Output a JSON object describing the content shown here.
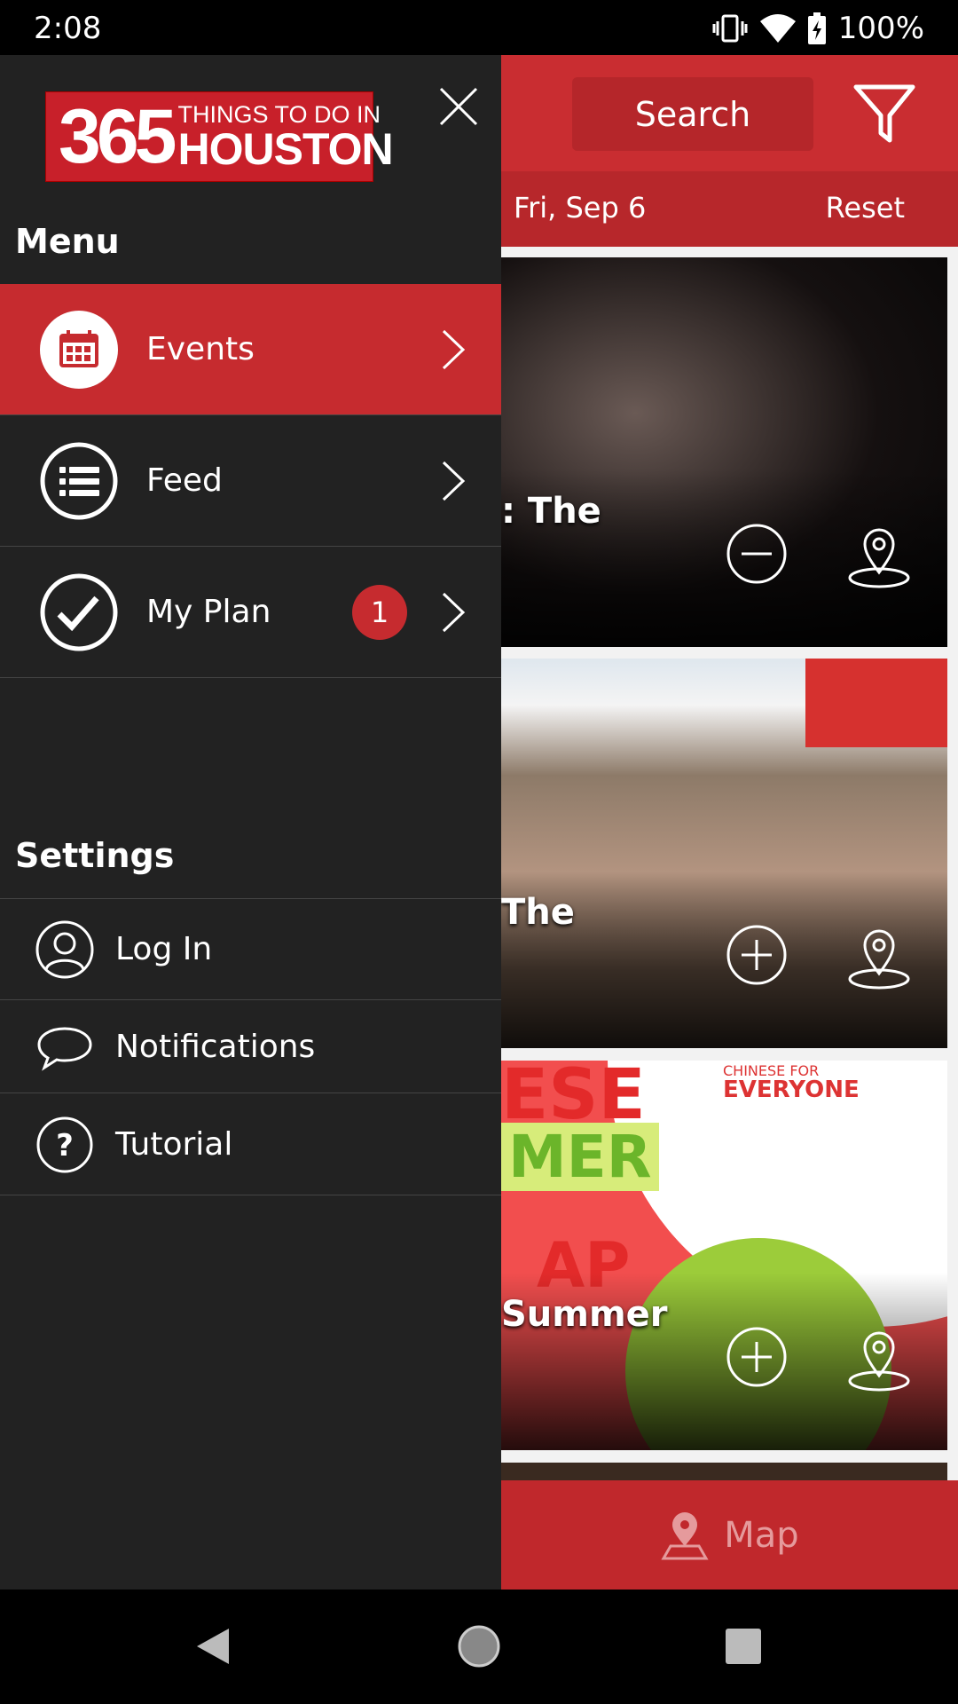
{
  "status_bar": {
    "time": "2:08",
    "battery": "100%",
    "icons": [
      "vibrate-icon",
      "wifi-icon",
      "battery-charging-icon"
    ]
  },
  "header": {
    "search_label": "Search",
    "filter_icon": "filter-icon"
  },
  "date_bar": {
    "date": "Fri, Sep 6",
    "reset_label": "Reset"
  },
  "cards": [
    {
      "title_fragment": ": The",
      "plan_action": "remove",
      "icons": [
        "minus-circle-icon",
        "map-pin-icon"
      ]
    },
    {
      "title_fragment": "The",
      "plan_action": "add",
      "icons": [
        "plus-circle-icon",
        "map-pin-icon"
      ]
    },
    {
      "title_fragment": "Summer",
      "plan_action": "add",
      "image_text": [
        "ESE",
        "MER",
        "AP",
        "CHINESE FOR",
        "EVERYONE"
      ],
      "icons": [
        "plus-circle-icon",
        "map-pin-icon"
      ]
    }
  ],
  "map_bar": {
    "label": "Map"
  },
  "drawer": {
    "logo": {
      "number": "365",
      "line1": "THINGS TO DO IN",
      "line2": "HOUSTON"
    },
    "menu_heading": "Menu",
    "menu_items": [
      {
        "label": "Events",
        "icon": "calendar-icon",
        "active": true
      },
      {
        "label": "Feed",
        "icon": "list-icon",
        "active": false
      },
      {
        "label": "My Plan",
        "icon": "check-circle-icon",
        "badge": "1",
        "active": false
      }
    ],
    "settings_heading": "Settings",
    "settings_items": [
      {
        "label": "Log In",
        "icon": "user-icon"
      },
      {
        "label": "Notifications",
        "icon": "chat-bubble-icon"
      },
      {
        "label": "Tutorial",
        "icon": "help-icon"
      }
    ]
  },
  "colors": {
    "brand_red": "#c62b2f",
    "drawer_bg": "#222222",
    "date_bar": "#b7272b"
  }
}
